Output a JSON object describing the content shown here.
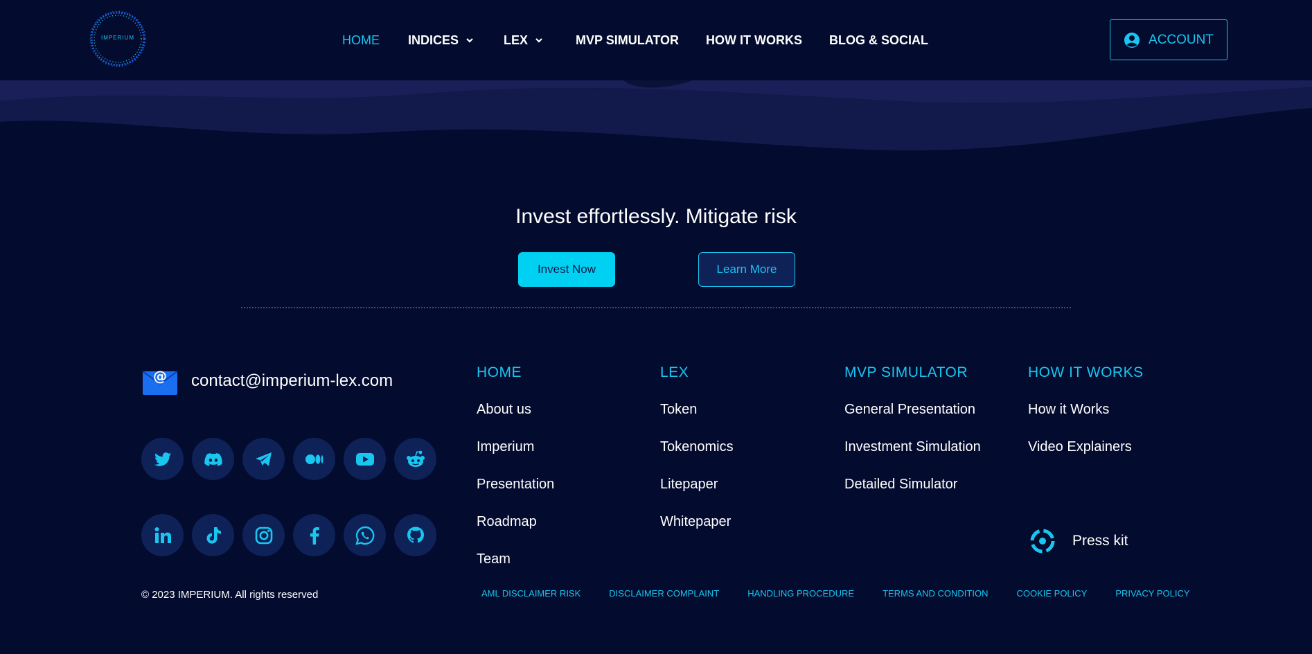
{
  "header": {
    "logo_text": "IMPERIUM",
    "nav": [
      {
        "label": "HOME",
        "active": true
      },
      {
        "label": "INDICES",
        "dropdown": true
      },
      {
        "label": "LEX",
        "dropdown": true
      },
      {
        "label": "MVP SIMULATOR"
      },
      {
        "label": "HOW IT WORKS"
      },
      {
        "label": "BLOG & SOCIAL"
      }
    ],
    "account_label": "ACCOUNT"
  },
  "cta": {
    "tagline": "Invest effortlessly. Mitigate risk",
    "invest_label": "Invest Now",
    "learn_label": "Learn More"
  },
  "contact": {
    "email": "contact@imperium-lex.com"
  },
  "social": {
    "row1": [
      "twitter-icon",
      "discord-icon",
      "telegram-icon",
      "medium-icon",
      "youtube-icon",
      "reddit-icon"
    ],
    "row2": [
      "linkedin-icon",
      "tiktok-icon",
      "instagram-icon",
      "facebook-icon",
      "whatsapp-icon",
      "github-icon"
    ]
  },
  "columns": [
    {
      "title": "HOME",
      "links": [
        "About us",
        "Imperium",
        "Presentation",
        "Roadmap",
        "Team"
      ]
    },
    {
      "title": "LEX",
      "links": [
        "Token",
        "Tokenomics",
        "Litepaper",
        "Whitepaper"
      ]
    },
    {
      "title": "MVP SIMULATOR",
      "links": [
        "General Presentation",
        "Investment Simulation",
        "Detailed Simulator"
      ]
    },
    {
      "title": "HOW IT WORKS",
      "links": [
        "How it Works",
        "Video Explainers"
      ]
    }
  ],
  "press_kit": "Press kit",
  "copyright": "© 2023 IMPERIUM. All rights reserved",
  "legal": [
    "AML DISCLAIMER RISK",
    "DISCLAIMER COMPLAINT",
    "HANDLING PROCEDURE",
    "TERMS AND CONDITION",
    "COOKIE POLICY",
    "PRIVACY POLICY"
  ],
  "colors": {
    "background": "#030b2e",
    "accent": "#19c6f0",
    "button_fill": "#00d1f2",
    "circle_bg": "#0f2258"
  }
}
